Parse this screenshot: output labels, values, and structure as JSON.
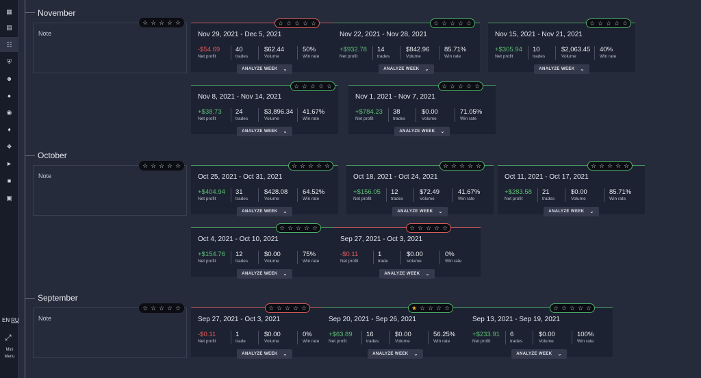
{
  "sidebar": {
    "icons": [
      "dashboard-icon",
      "broadcast-icon",
      "network-icon",
      "shield-icon",
      "users-icon",
      "user-icon",
      "analytics-icon",
      "trophy-icon",
      "settings-icon",
      "megaphone-icon",
      "book-icon",
      "chat-icon"
    ],
    "languages": [
      "EN",
      "RU"
    ],
    "mini_menu_label": "Mini Menu"
  },
  "note_label": "Note",
  "analyze_label": "ANALYZE WEEK",
  "labels": {
    "net_profit": "Net profit",
    "volume": "Volume",
    "win_rate": "Win rate"
  },
  "months": [
    {
      "name": "November",
      "note_rating": 0,
      "weeks": [
        {
          "date": "Nov 29, 2021 - Dec 5, 2021",
          "profit": "-$54.69",
          "trades": "40",
          "trades_label": "trades",
          "volume": "$62.44",
          "win_rate": "50%",
          "rating": 0
        },
        {
          "date": "Nov 22, 2021 - Nov 28, 2021",
          "profit": "+$932.78",
          "trades": "14",
          "trades_label": "trades",
          "volume": "$842.96",
          "win_rate": "85.71%",
          "rating": 0
        },
        {
          "date": "Nov 15, 2021 - Nov 21, 2021",
          "profit": "+$305.94",
          "trades": "10",
          "trades_label": "trades",
          "volume": "$2,063.45",
          "win_rate": "40%",
          "rating": 0
        },
        {
          "date": "Nov 8, 2021 - Nov 14, 2021",
          "profit": "+$38.73",
          "trades": "24",
          "trades_label": "trades",
          "volume": "$3,896.34",
          "win_rate": "41.67%",
          "rating": 0
        },
        {
          "date": "Nov 1, 2021 - Nov 7, 2021",
          "profit": "+$784.23",
          "trades": "38",
          "trades_label": "trades",
          "volume": "$0.00",
          "win_rate": "71.05%",
          "rating": 0
        }
      ]
    },
    {
      "name": "October",
      "note_rating": 0,
      "weeks": [
        {
          "date": "Oct 25, 2021 - Oct 31, 2021",
          "profit": "+$404.94",
          "trades": "31",
          "trades_label": "trades",
          "volume": "$428.08",
          "win_rate": "64.52%",
          "rating": 0
        },
        {
          "date": "Oct 18, 2021 - Oct 24, 2021",
          "profit": "+$156.05",
          "trades": "12",
          "trades_label": "trades",
          "volume": "$72.49",
          "win_rate": "41.67%",
          "rating": 0
        },
        {
          "date": "Oct 11, 2021 - Oct 17, 2021",
          "profit": "+$283.58",
          "trades": "21",
          "trades_label": "trades",
          "volume": "$0.00",
          "win_rate": "85.71%",
          "rating": 0
        },
        {
          "date": "Oct 4, 2021 - Oct 10, 2021",
          "profit": "+$154.76",
          "trades": "12",
          "trades_label": "trades",
          "volume": "$0.00",
          "win_rate": "75%",
          "rating": 0
        },
        {
          "date": "Sep 27, 2021 - Oct 3, 2021",
          "profit": "-$0.11",
          "trades": "1",
          "trades_label": "trade",
          "volume": "$0.00",
          "win_rate": "0%",
          "rating": 0
        }
      ]
    },
    {
      "name": "September",
      "note_rating": 0,
      "weeks": [
        {
          "date": "Sep 27, 2021 - Oct 3, 2021",
          "profit": "-$0.11",
          "trades": "1",
          "trades_label": "trade",
          "volume": "$0.00",
          "win_rate": "0%",
          "rating": 0
        },
        {
          "date": "Sep 20, 2021 - Sep 26, 2021",
          "profit": "+$63.89",
          "trades": "16",
          "trades_label": "trades",
          "volume": "$0.00",
          "win_rate": "56.25%",
          "rating": 1
        },
        {
          "date": "Sep 13, 2021 - Sep 19, 2021",
          "profit": "+$233.91",
          "trades": "6",
          "trades_label": "trades",
          "volume": "$0.00",
          "win_rate": "100%",
          "rating": 0
        }
      ]
    }
  ],
  "colors": {
    "loss": "#e05a5a",
    "gain": "#5cbf73",
    "star_on": "#f2b431"
  }
}
